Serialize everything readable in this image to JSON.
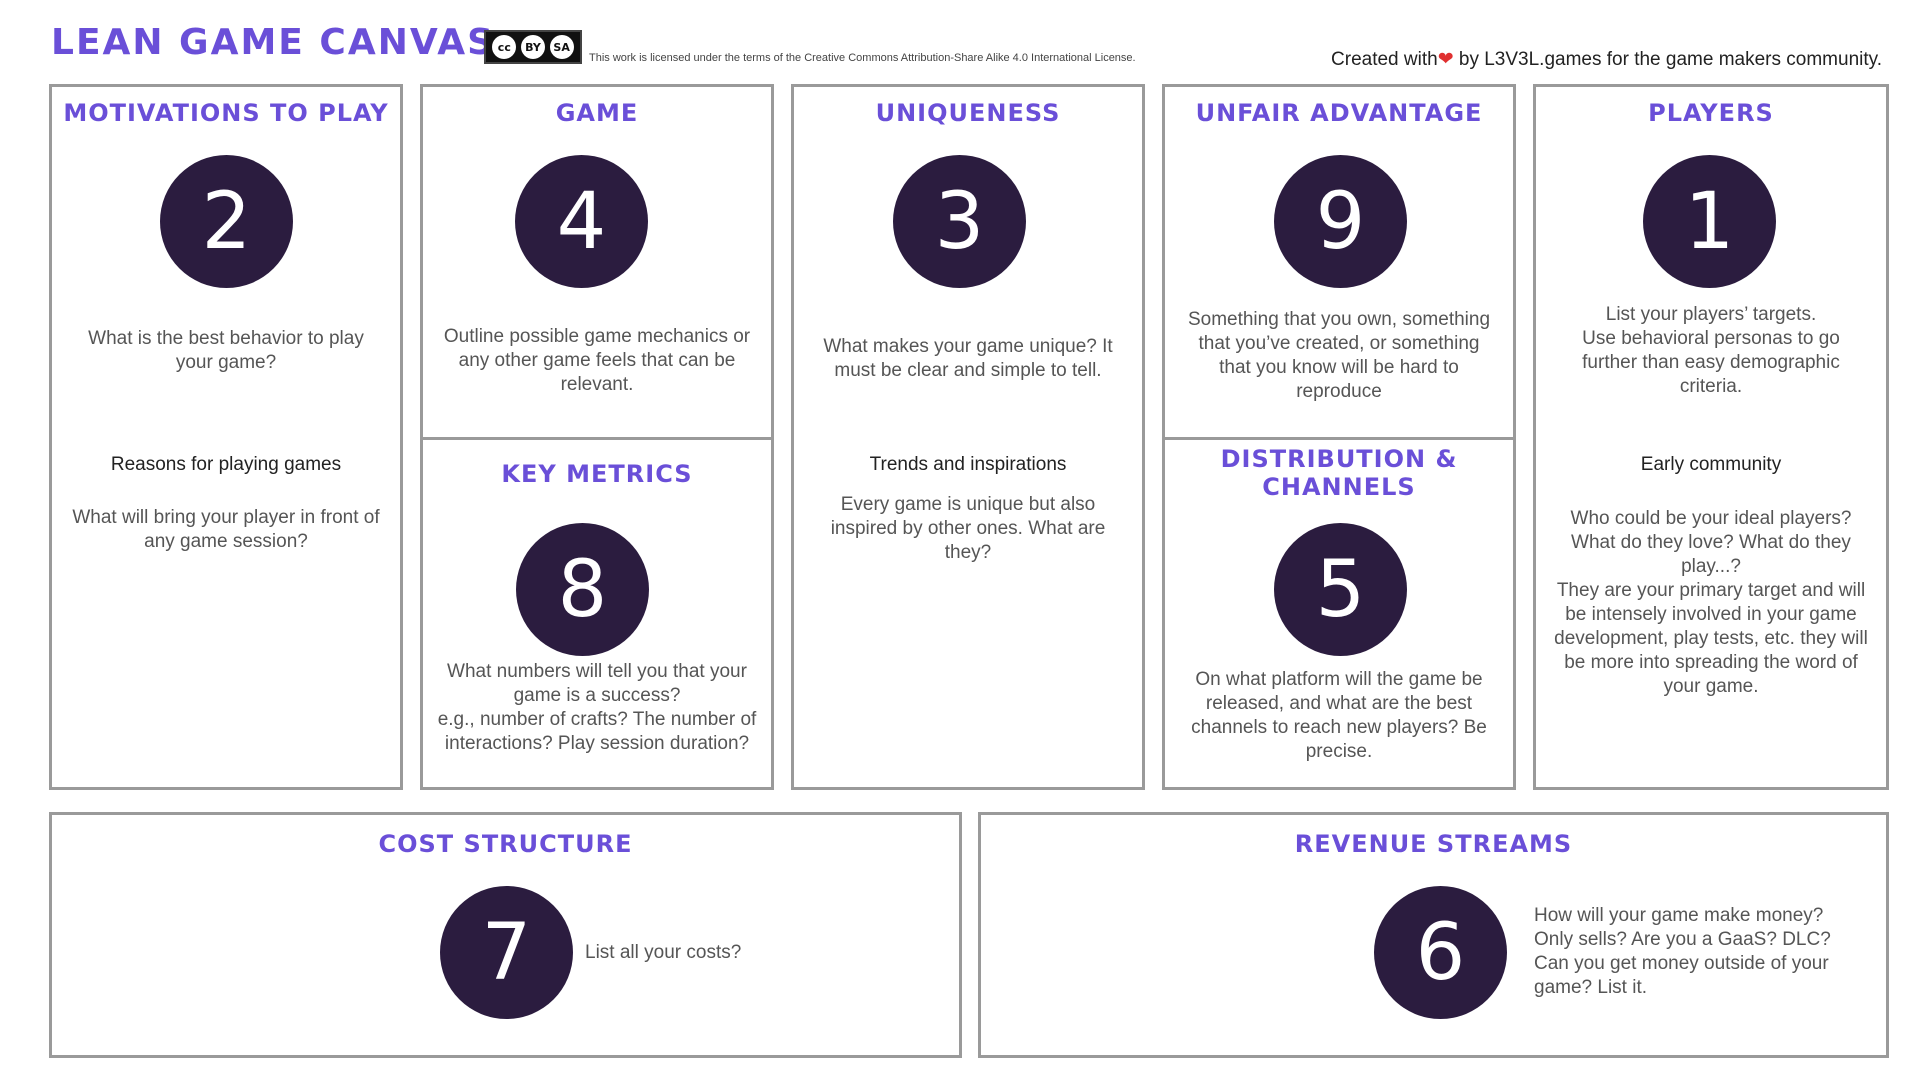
{
  "header": {
    "title": "LEAN GAME CANVAS",
    "license_badge": {
      "cc": "cc",
      "by": "BY",
      "sa": "SA"
    },
    "license_text": "This work is licensed under the terms of the Creative Commons Attribution-Share Alike 4.0 International License.",
    "created_prefix": "Created with",
    "created_heart": "❤",
    "created_suffix": " by L3V3L.games for the game makers community."
  },
  "colors": {
    "accent": "#6a4fd8",
    "circle": "#2b1c3f",
    "border": "#9a9a9a",
    "heart": "#e03030"
  },
  "sections": {
    "motivations": {
      "title": "MOTIVATIONS TO PLAY",
      "number": "2",
      "question": "What is the best behavior to play your game?",
      "sub_title": "Reasons for playing games",
      "sub_question": "What will bring your player in front of any game session?"
    },
    "game": {
      "title": "GAME",
      "number": "4",
      "question": "Outline possible game mechanics or any other game feels that can be relevant."
    },
    "key_metrics": {
      "title": "KEY METRICS",
      "number": "8",
      "question": "What numbers will tell you that your game is a success?\ne.g., number of crafts? The number of interactions? Play session duration?"
    },
    "uniqueness": {
      "title": "UNIQUENESS",
      "number": "3",
      "question": "What makes your game unique? It must be clear and simple to tell.",
      "sub_title": "Trends and inspirations",
      "sub_question": "Every game is unique but also inspired by other ones. What are they?"
    },
    "unfair_advantage": {
      "title": "UNFAIR ADVANTAGE",
      "number": "9",
      "question": "Something that you own, something that you’ve created, or something that you know will be hard to reproduce"
    },
    "distribution": {
      "title": "DISTRIBUTION & CHANNELS",
      "number": "5",
      "question": "On what platform will the game be released, and what are the best channels to reach new players? Be precise."
    },
    "players": {
      "title": "PLAYERS",
      "number": "1",
      "question": "List your players’ targets.\nUse behavioral personas to go further than easy demographic criteria.",
      "sub_title": "Early community",
      "sub_question": "Who could be your ideal players? What do they love? What do they play...?\nThey are your primary target and will be intensely involved in your game development, play tests, etc. they will be more into spreading the word of your game."
    },
    "cost_structure": {
      "title": "COST STRUCTURE",
      "number": "7",
      "question": "List all your costs?"
    },
    "revenue_streams": {
      "title": "REVENUE STREAMS",
      "number": "6",
      "question": "How will your game make money?\nOnly sells? Are you a GaaS? DLC?\nCan you get money outside of your game? List it."
    }
  }
}
